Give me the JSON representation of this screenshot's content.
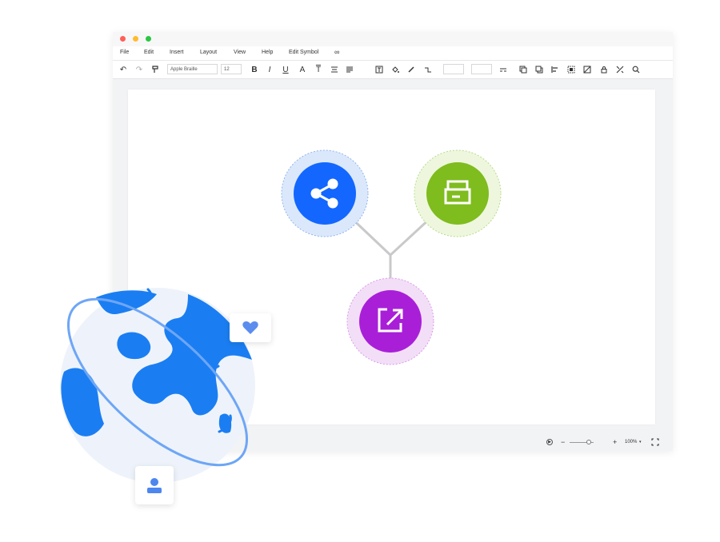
{
  "window": {
    "traffic_lights": [
      "#ff5f57",
      "#febc2e",
      "#28c840"
    ]
  },
  "menu": {
    "items": [
      "File",
      "Edit",
      "Insert",
      "Layout",
      "View",
      "Help",
      "Edit Symbol"
    ]
  },
  "toolbar": {
    "font_family": "Apple Braille",
    "font_size": "12",
    "icons": [
      "undo-icon",
      "redo-icon",
      "format-painter-icon",
      "bold-icon",
      "italic-icon",
      "underline-icon",
      "font-color-icon",
      "text-style-icon",
      "align-icon",
      "line-spacing-icon",
      "text-box-icon",
      "fill-icon",
      "line-color-icon",
      "connector-icon",
      "line-style-icon",
      "front-icon",
      "back-icon",
      "align-left-icon",
      "group-icon",
      "no-fill-icon",
      "lock-icon",
      "tools-icon",
      "search-icon"
    ]
  },
  "diagram": {
    "nodes": [
      {
        "name": "share-node",
        "icon": "share-icon",
        "color": "#1367ff",
        "halo": "#dbe8fb"
      },
      {
        "name": "print-node",
        "icon": "printer-icon",
        "color": "#7fbc1e",
        "halo": "#eef7dd"
      },
      {
        "name": "export-node",
        "icon": "export-icon",
        "color": "#a91fd8",
        "halo": "#f3def8"
      }
    ],
    "connector_color": "#c9c9cc"
  },
  "statusbar": {
    "zoom": "100%",
    "minus": "−",
    "plus": "+"
  },
  "decor": {
    "globe_color": "#1a7ef2",
    "globe_bg": "#eef3fb",
    "orbit_color": "#6ea6f6",
    "heart_color": "#5b8def",
    "user_color": "#4d86ee"
  }
}
